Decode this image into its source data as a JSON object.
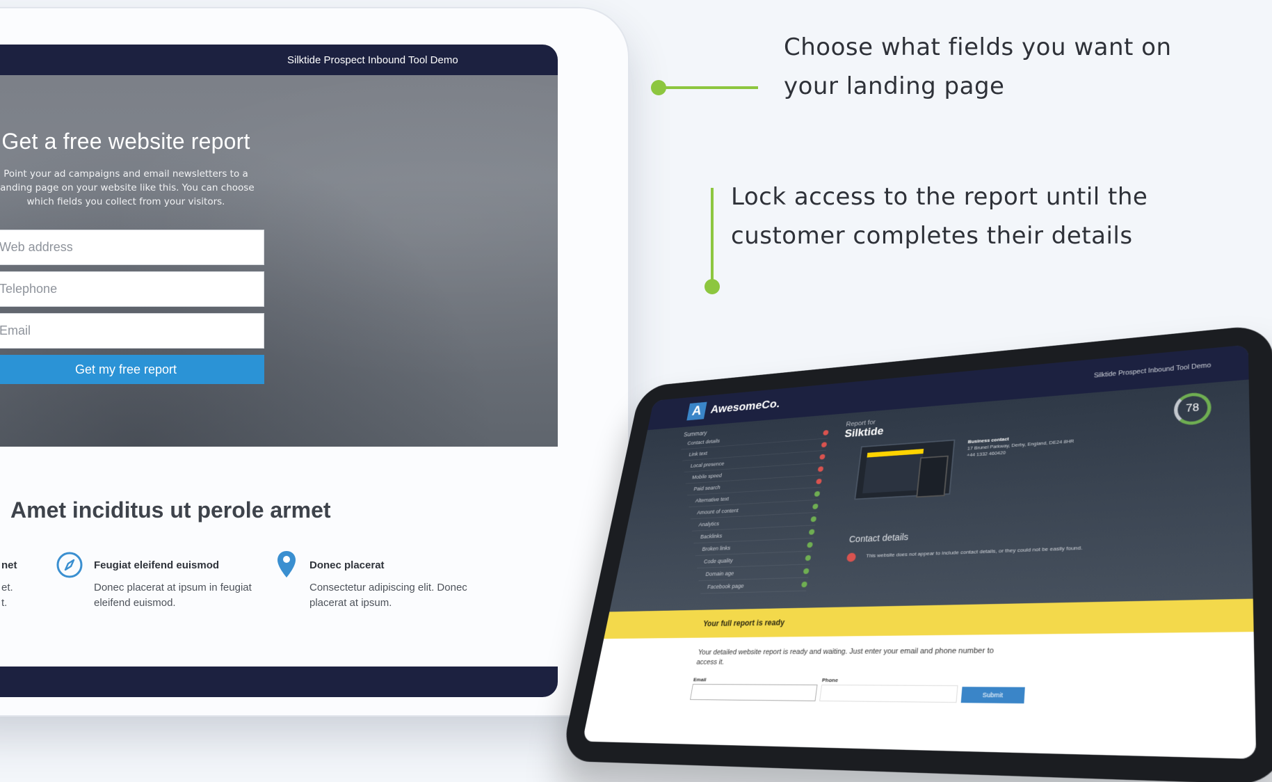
{
  "left_page": {
    "topbar_title": "Silktide Prospect Inbound Tool Demo",
    "hero": {
      "title": "Get a free website report",
      "description": "Point your ad campaigns and email newsletters to a landing page on your website like this. You can choose which fields you collect from your visitors.",
      "fields": {
        "web_address": "Web address",
        "telephone": "Telephone",
        "email": "Email"
      },
      "button_label": "Get my free report"
    },
    "section_title": "Amet inciditus ut perole armet",
    "features": [
      {
        "title": "net",
        "text": "et.\nt."
      },
      {
        "title": "Feugiat eleifend euismod",
        "text": "Donec placerat at ipsum in feugiat eleifend euismod.",
        "icon": "compass-icon"
      },
      {
        "title": "Donec placerat",
        "text": "Consectetur adipiscing elit. Donec placerat at ipsum.",
        "icon": "map-pin-icon"
      }
    ]
  },
  "callouts": {
    "fields": "Choose what fields you want on your landing page",
    "lock": "Lock access to the report until the customer completes their details"
  },
  "report": {
    "logo_letter": "A",
    "brand": "AwesomeCo.",
    "demo_title": "Silktide Prospect Inbound Tool Demo",
    "sidebar_heading": "Summary",
    "sidebar_items": [
      {
        "label": "Contact details",
        "status": "fail"
      },
      {
        "label": "Link text",
        "status": "fail"
      },
      {
        "label": "Local presence",
        "status": "fail"
      },
      {
        "label": "Mobile speed",
        "status": "fail"
      },
      {
        "label": "Paid search",
        "status": "fail"
      },
      {
        "label": "Alternative text",
        "status": "pass"
      },
      {
        "label": "Amount of content",
        "status": "pass"
      },
      {
        "label": "Analytics",
        "status": "pass"
      },
      {
        "label": "Backlinks",
        "status": "pass"
      },
      {
        "label": "Broken links",
        "status": "pass"
      },
      {
        "label": "Code quality",
        "status": "pass"
      },
      {
        "label": "Domain age",
        "status": "pass"
      },
      {
        "label": "Facebook page",
        "status": "pass"
      }
    ],
    "report_for": "Report for",
    "company": "Silktide",
    "score": "78",
    "business_contact_title": "Business contact",
    "business_address": "17 Brunel Parkway, Derby, England, DE24 8HR",
    "business_phone": "+44 1332 460420",
    "contact_details_title": "Contact details",
    "contact_details_message": "This website does not appear to include contact details, or they could not be easily found.",
    "banner": "Your full report is ready",
    "form_message": "Your detailed website report is ready and waiting. Just enter your email and phone number to access it.",
    "email_label": "Email",
    "phone_label": "Phone",
    "submit_label": "Submit"
  },
  "colors": {
    "navy": "#1c2140",
    "accent_blue": "#2b93d6",
    "callout_green": "#8dc63f",
    "banner_yellow": "#f3d94b",
    "fail_red": "#d9534f",
    "pass_green": "#6fae52"
  }
}
